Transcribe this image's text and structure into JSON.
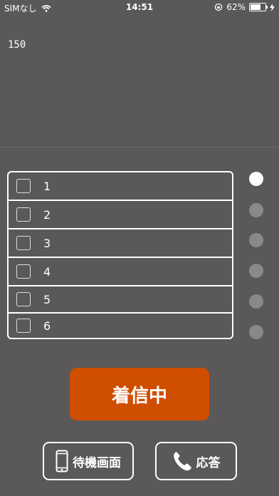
{
  "status_bar": {
    "carrier": "SIMなし",
    "time": "14:51",
    "battery": "62%",
    "icons": [
      "wifi-icon",
      "orientation-lock-icon",
      "battery-icon",
      "charging-icon"
    ]
  },
  "counter": "150",
  "items": [
    {
      "label": "1",
      "checked": false
    },
    {
      "label": "2",
      "checked": false
    },
    {
      "label": "3",
      "checked": false
    },
    {
      "label": "4",
      "checked": false
    },
    {
      "label": "5",
      "checked": false
    },
    {
      "label": "6",
      "checked": false
    }
  ],
  "indicators": {
    "count": 6,
    "active_index": 0
  },
  "incoming_button": {
    "label": "着信中",
    "color": "#d04e00"
  },
  "standby_button": {
    "label": "待機画面",
    "icon": "smartphone-icon"
  },
  "answer_button": {
    "label": "応答",
    "icon": "phone-icon"
  },
  "colors": {
    "background": "#5a5858",
    "accent": "#d04e00",
    "indicator_inactive": "#8a8888"
  }
}
